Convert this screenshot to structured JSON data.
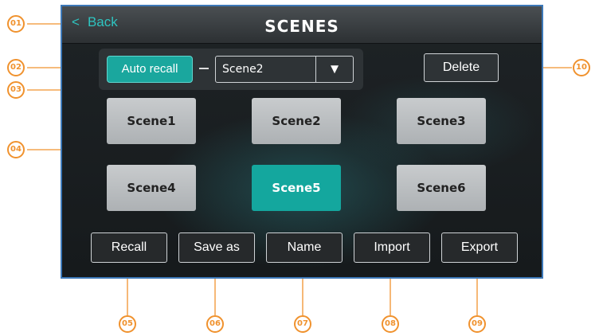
{
  "header": {
    "back_label": "Back",
    "back_chevron": "<",
    "title": "SCENES"
  },
  "recall": {
    "auto_recall_label": "Auto recall",
    "selected_scene": "Scene2"
  },
  "delete_label": "Delete",
  "scenes": [
    "Scene1",
    "Scene2",
    "Scene3",
    "Scene4",
    "Scene5",
    "Scene6"
  ],
  "active_scene": "Scene5",
  "actions": [
    "Recall",
    "Save as",
    "Name",
    "Import",
    "Export"
  ],
  "callouts": [
    "01",
    "02",
    "03",
    "04",
    "05",
    "06",
    "07",
    "08",
    "09",
    "10"
  ],
  "colors": {
    "accent": "#1aa79e",
    "callout": "#f0922e",
    "back_text": "#2ec4c0",
    "frame": "#3c78b8"
  }
}
